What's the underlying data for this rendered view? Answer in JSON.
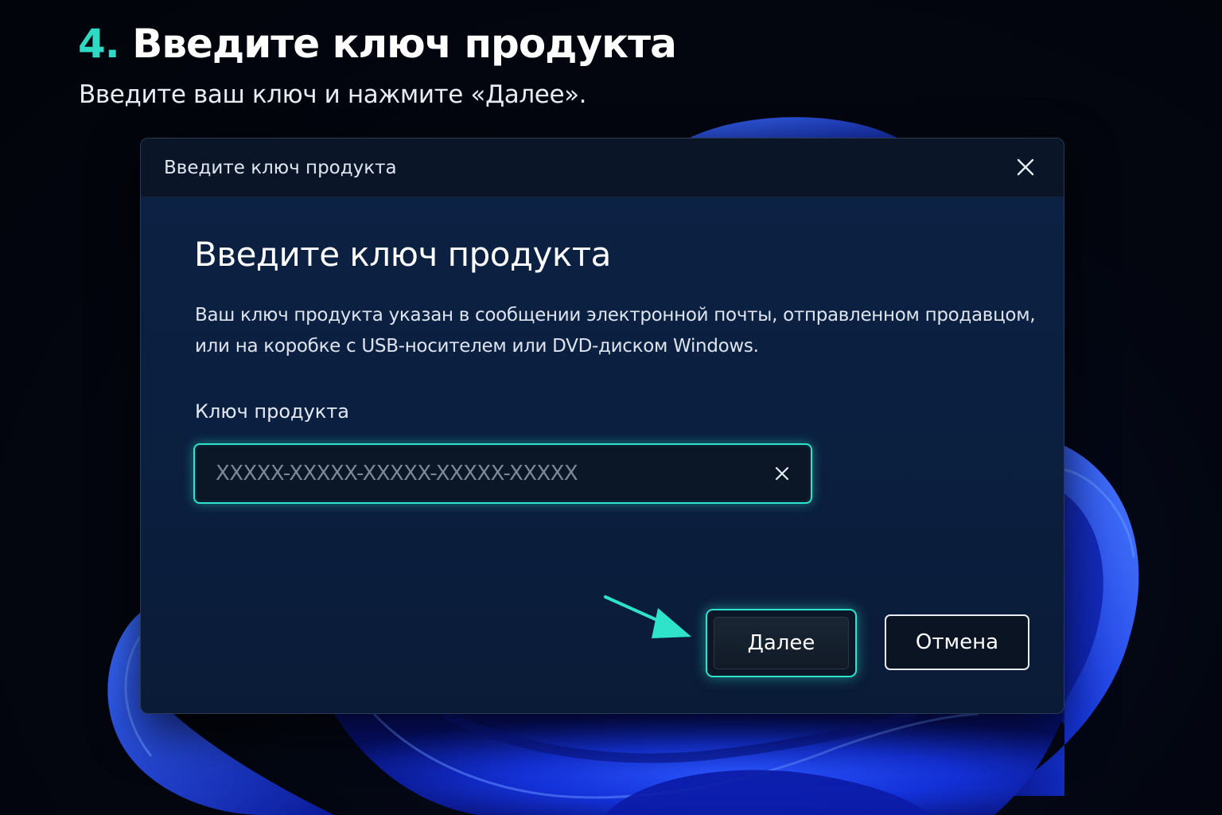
{
  "page": {
    "step_number": "4.",
    "step_title": "Введите ключ продукта",
    "step_subtitle": "Введите ваш ключ и нажмите «Далее»."
  },
  "dialog": {
    "titlebar_title": "Введите ключ продукта",
    "heading": "Введите ключ продукта",
    "description_line1": "Ваш ключ продукта указан в сообщении электронной почты, отправленном продавцом,",
    "description_line2": "или на коробке с USB-носителем или DVD-диском Windows.",
    "field_label": "Ключ продукта",
    "key_input": {
      "value": "",
      "placeholder": "XXXXX-XXXXX-XXXXX-XXXXX-XXXXX"
    },
    "next_label": "Далее",
    "cancel_label": "Отмена"
  },
  "icons": {
    "titlebar_close": "close-icon",
    "input_clear": "clear-icon",
    "pointer": "arrow-pointer-icon"
  },
  "colors": {
    "accent": "#2fe3cb",
    "step_number": "#2fd9c4",
    "dialog_bg": "#0b1f3f",
    "titlebar_bg": "#0a1628",
    "wallpaper_bloom": "#1a3cff"
  }
}
